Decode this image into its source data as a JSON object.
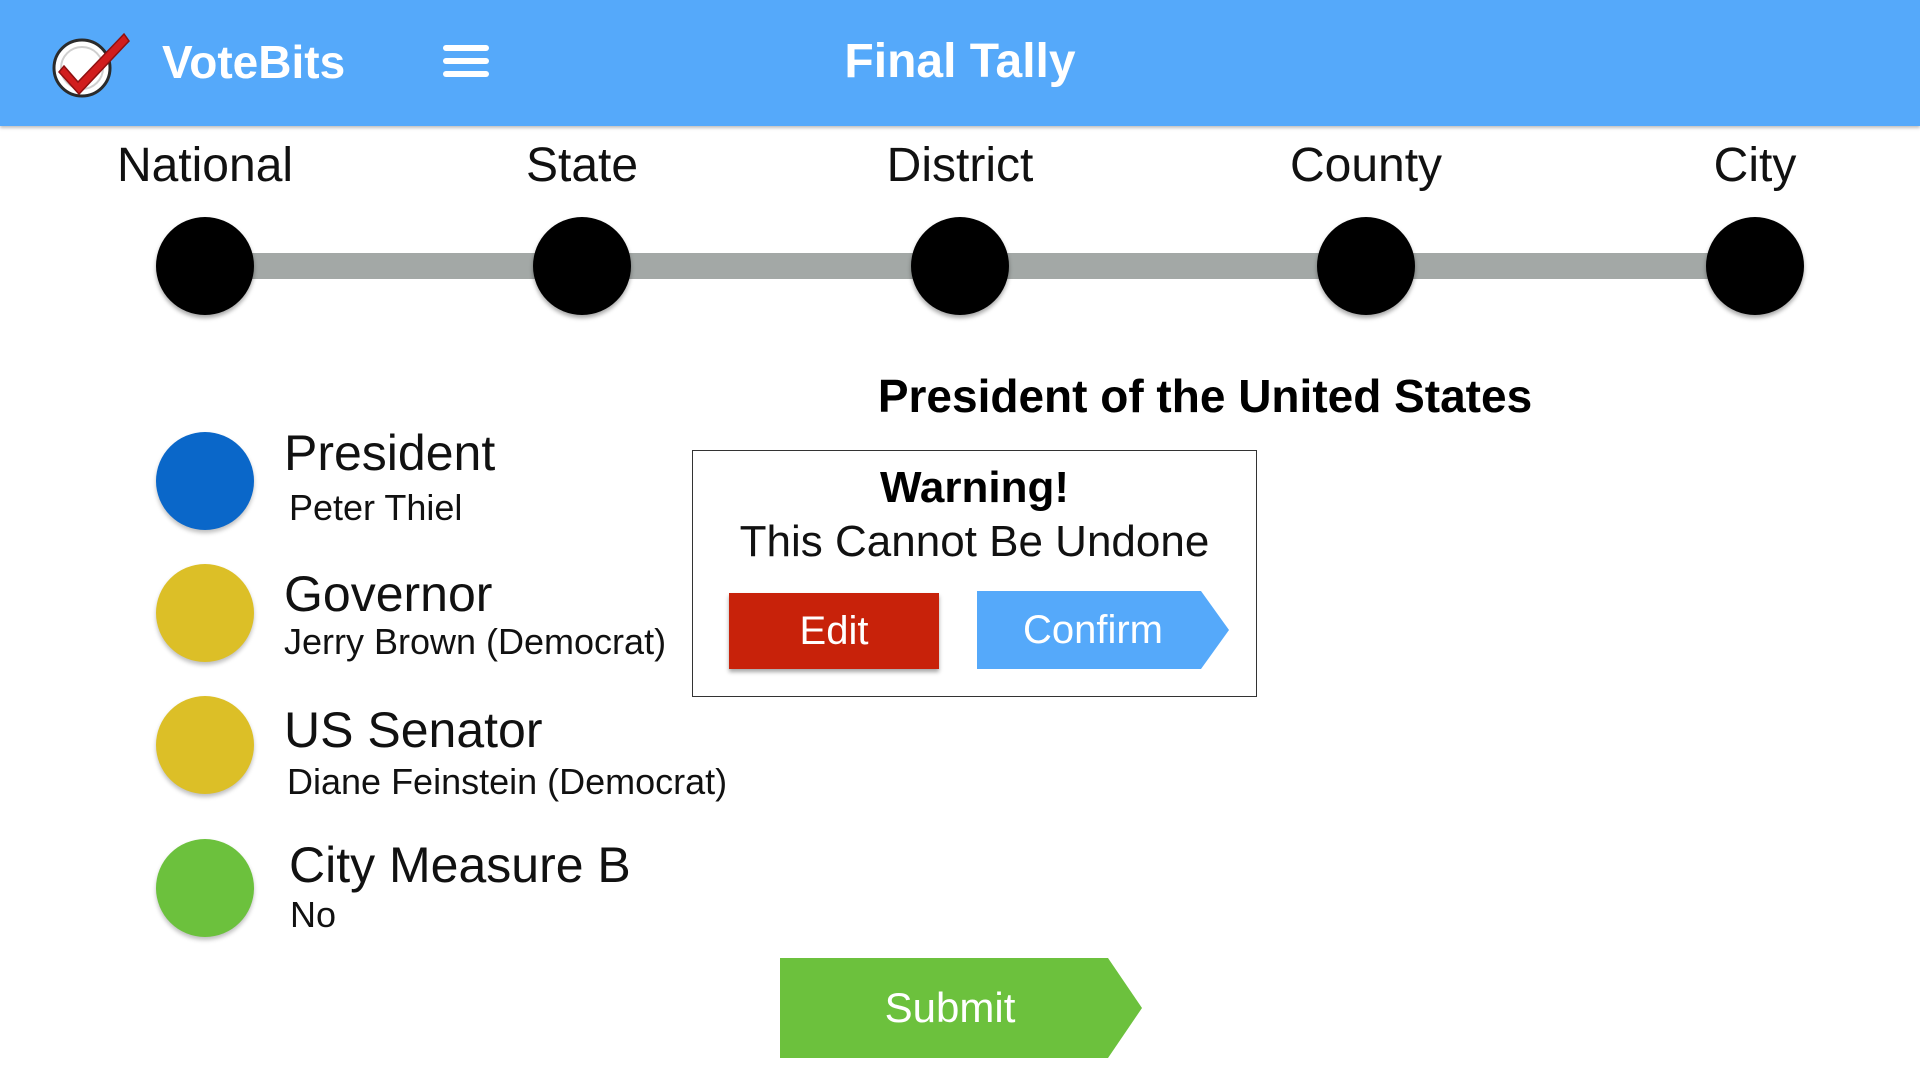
{
  "header": {
    "app_name": "VoteBits",
    "title": "Final Tally",
    "logo_icon": "checkmark-ballot-icon",
    "menu_icon": "hamburger-menu-icon",
    "background_color": "#55a9fa"
  },
  "levels": [
    {
      "label": "National"
    },
    {
      "label": "State"
    },
    {
      "label": "District"
    },
    {
      "label": "County"
    },
    {
      "label": "City"
    }
  ],
  "section_title": "President of the United States",
  "races": [
    {
      "name": "President",
      "choice": "Peter Thiel",
      "color": "#0a67c9"
    },
    {
      "name": "Governor",
      "choice": "Jerry Brown  (Democrat)",
      "color": "#dcbf27"
    },
    {
      "name": "US Senator",
      "choice": "Diane Feinstein (Democrat)",
      "color": "#dcbf27"
    },
    {
      "name": "City Measure B",
      "choice": "No",
      "color": "#6cc13d"
    }
  ],
  "dialog": {
    "title": "Warning!",
    "message": "This Cannot Be Undone",
    "edit_label": "Edit",
    "confirm_label": "Confirm",
    "edit_color": "#c8220a",
    "confirm_color": "#55a9fa"
  },
  "submit": {
    "label": "Submit",
    "color": "#6cc13d"
  }
}
